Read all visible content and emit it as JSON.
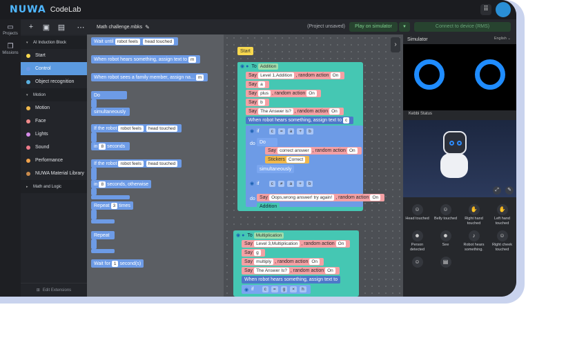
{
  "app": {
    "logo": "NUWA",
    "name": "CodeLab"
  },
  "rail": {
    "projects": "Projects",
    "missions": "Missions"
  },
  "toolbar": {
    "filename": "Math challenge.mbks",
    "status": "(Project unsaved)",
    "play": "Play on simulator",
    "connect": "Connect to device (RMS)"
  },
  "categories": [
    {
      "label": "AI Induction Block",
      "kind": "header"
    },
    {
      "label": "Start",
      "color": "#f7d84e"
    },
    {
      "label": "Control",
      "color": "#6d9be6",
      "selected": true
    },
    {
      "label": "Object recognition",
      "color": "#5ab0e0"
    },
    {
      "label": "Motion",
      "kind": "header"
    },
    {
      "label": "Motion",
      "color": "#f0b84c"
    },
    {
      "label": "Face",
      "color": "#f08b8b"
    },
    {
      "label": "Lights",
      "color": "#d58be8"
    },
    {
      "label": "Sound",
      "color": "#ee7b8a"
    },
    {
      "label": "Performance",
      "color": "#f0a24c"
    },
    {
      "label": "NUWA Material Library",
      "color": "#c98b4c"
    },
    {
      "label": "Math and Logic",
      "kind": "header"
    }
  ],
  "edit_extensions": "Edit Extensions",
  "palette": {
    "wait_until": "Wait until",
    "robot_feels": "robot feels",
    "head_touched": "head touched",
    "hears_assign": "When robot hears something, assign text to",
    "m": "m",
    "sees_family": "When robot sees a family member, assign na...",
    "do": "Do",
    "simultaneously": "simultaneously",
    "if_robot": "If the robot",
    "in": "in",
    "seconds": "seconds",
    "n8": "8",
    "seconds_otherwise": "seconds, otherwise",
    "repeat": "Repeat",
    "n3": "3",
    "times": "times",
    "wait_for": "Wait for",
    "n1": "1",
    "seconds_s": "second(s)"
  },
  "ws": {
    "start": "Start",
    "to": "To",
    "addition": "Addition",
    "say": "Say",
    "level1": "Level 1,Addition",
    "random_action": ", random action",
    "on": "On",
    "a": "a",
    "plus": "plus",
    "b": "b",
    "answer_is": "The Answer Is?",
    "hears": "When robot hears something, assign text to",
    "c": "c",
    "if": "if",
    "eq": "=",
    "plus_op": "+",
    "do": "do",
    "do2": "Do",
    "correct": "correct answer",
    "stickers": "Stickers",
    "correct2": "Correct",
    "simultaneously": "simultaneously",
    "neq": "≠",
    "oops": "Oops,wrong answer! try again!",
    "multiplication": "Multiplication",
    "level3": "Level 3,Multiplication",
    "g": "g",
    "multiply": "multiply",
    "h": "h",
    "times_op": "×"
  },
  "sim": {
    "title": "Simulator",
    "lang": "English",
    "kebbi": "Kebbi Status"
  },
  "triggers": [
    {
      "label": "Head touched",
      "icon": "☺"
    },
    {
      "label": "Belly touched",
      "icon": "☺"
    },
    {
      "label": "Right hand touched",
      "icon": "✋"
    },
    {
      "label": "Left hand touched",
      "icon": "✋"
    },
    {
      "label": "Person detected",
      "icon": "☻"
    },
    {
      "label": "See",
      "icon": "☻"
    },
    {
      "label": "Robot hears something.",
      "icon": "♪"
    },
    {
      "label": "Right cheek touched",
      "icon": "☺"
    },
    {
      "label": "",
      "icon": "☺"
    },
    {
      "label": "",
      "icon": "▤"
    }
  ]
}
